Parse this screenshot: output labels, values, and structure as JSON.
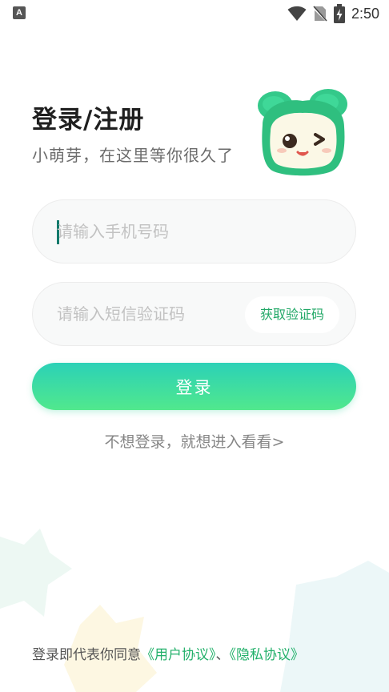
{
  "status_bar": {
    "left_icon_letter": "A",
    "time": "2:50",
    "icons": [
      "wifi-icon",
      "no-sim-icon",
      "battery-charging-icon"
    ]
  },
  "header": {
    "title": "登录/注册",
    "subtitle": "小萌芽，在这里等你很久了"
  },
  "form": {
    "phone": {
      "value": "",
      "placeholder": "请输入手机号码"
    },
    "code": {
      "value": "",
      "placeholder": "请输入短信验证码"
    },
    "get_code_label": "获取验证码",
    "login_label": "登录"
  },
  "skip_label": "不想登录，就想进入看看>",
  "agreement": {
    "prefix": "登录即代表你同意",
    "user_agreement": "《用户协议》",
    "separator": "、",
    "privacy_agreement": "《隐私协议》"
  },
  "colors": {
    "accent": "#22b06a",
    "button_gradient_top": "#2bd1b7",
    "button_gradient_bottom": "#51e88d"
  }
}
